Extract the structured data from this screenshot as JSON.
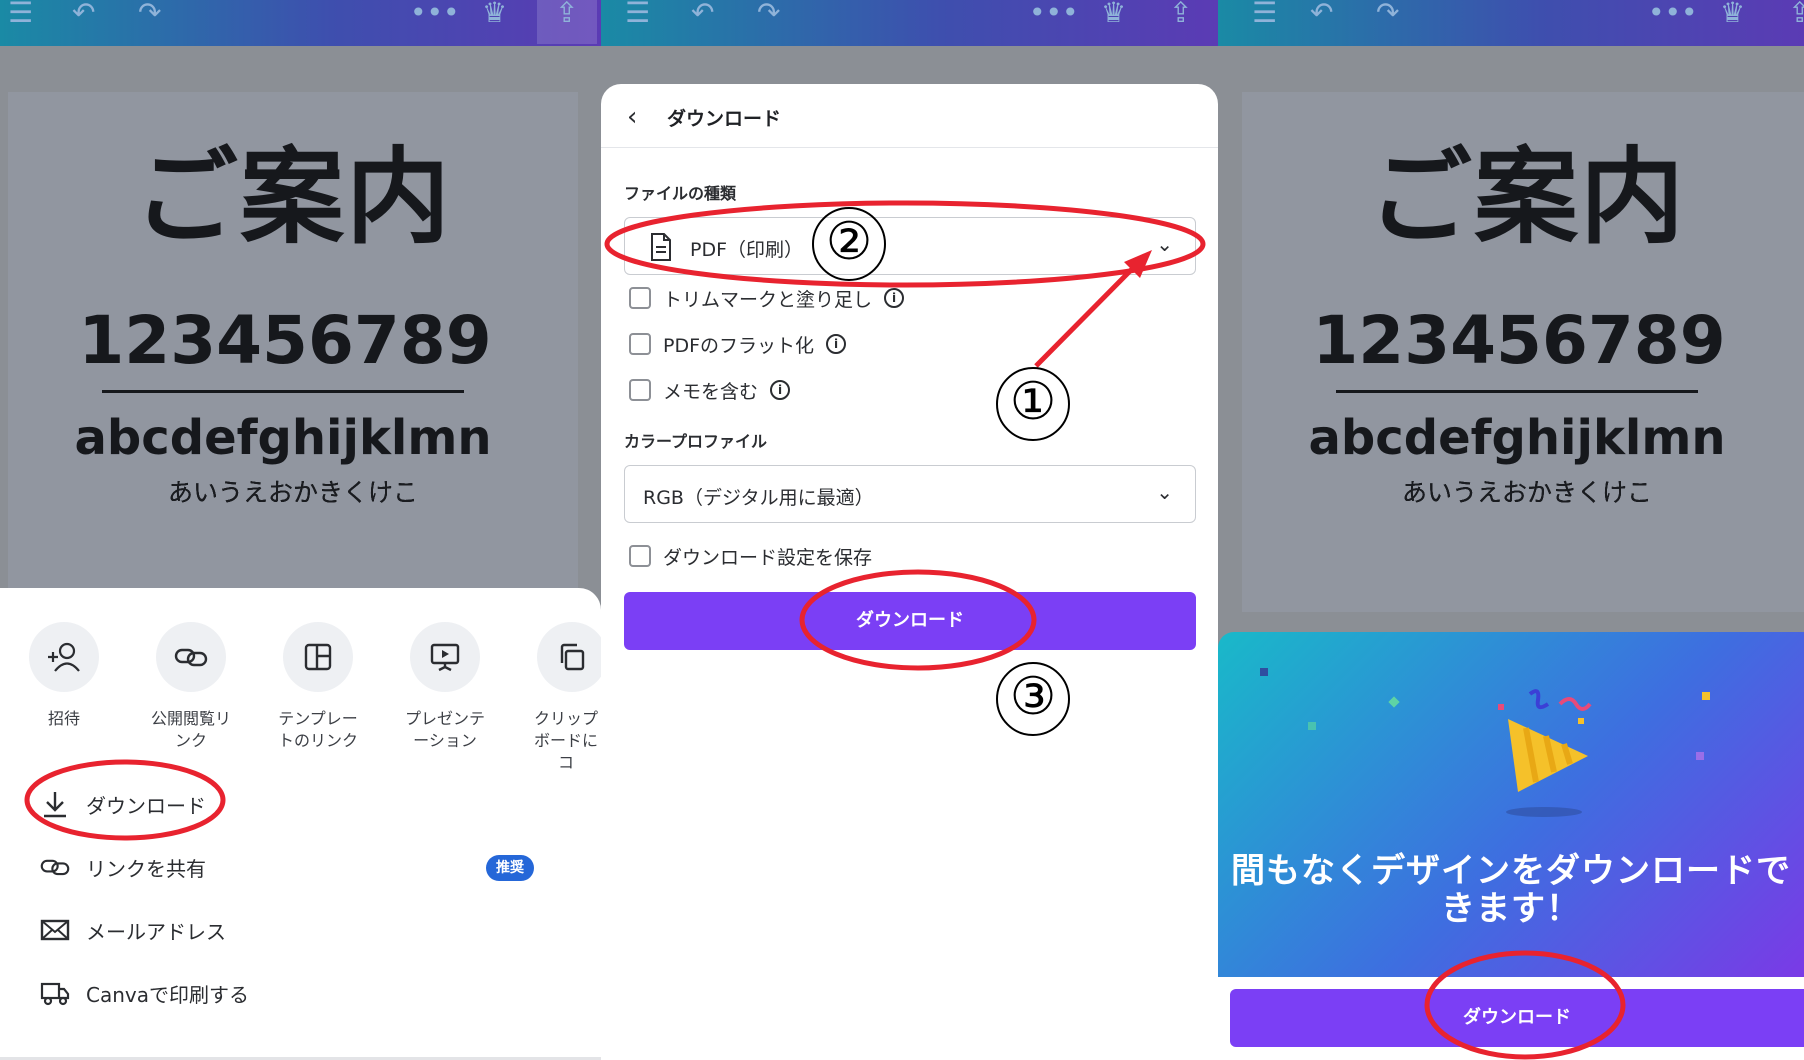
{
  "document": {
    "title": "ご案内",
    "number": "123456789",
    "alphabet": "abcdefghijklmn",
    "kana_lines": [
      "あいうえおかきくけこ",
      "あいうえおかきくけこ",
      "あいうえおかきくけこ",
      "あいうえおかきくけこ"
    ]
  },
  "share_sheet": {
    "actions": [
      {
        "label": "招待",
        "icon": "invite-icon"
      },
      {
        "label": "公開閲覧リンク",
        "icon": "link-icon"
      },
      {
        "label": "テンプレートのリンク",
        "icon": "template-icon"
      },
      {
        "label": "プレゼンテーション",
        "icon": "present-icon"
      },
      {
        "label": "クリップボードにコ",
        "icon": "copy-icon"
      }
    ],
    "menu": [
      {
        "label": "ダウンロード",
        "icon": "download-icon"
      },
      {
        "label": "リンクを共有",
        "icon": "link-icon",
        "badge": "推奨"
      },
      {
        "label": "メールアドレス",
        "icon": "mail-icon"
      },
      {
        "label": "Canvaで印刷する",
        "icon": "truck-icon"
      }
    ]
  },
  "download_dialog": {
    "title": "ダウンロード",
    "file_type_label": "ファイルの種類",
    "file_type_value": "PDF（印刷）",
    "options": [
      {
        "label": "トリムマークと塗り足し",
        "checked": false
      },
      {
        "label": "PDFのフラット化",
        "checked": false
      },
      {
        "label": "メモを含む",
        "checked": false
      }
    ],
    "color_profile_label": "カラープロファイル",
    "color_profile_value": "RGB（デジタル用に最適）",
    "save_settings_label": "ダウンロード設定を保存",
    "download_button": "ダウンロード"
  },
  "success": {
    "message": "間もなくデザインをダウンロードできます！",
    "download_button": "ダウンロード"
  },
  "annotations": {
    "step1": "①",
    "step2": "②",
    "step3": "③"
  },
  "colors": {
    "accent_purple": "#7b3ff5",
    "badge_blue": "#2567d8",
    "annotation_red": "#e8232f"
  }
}
